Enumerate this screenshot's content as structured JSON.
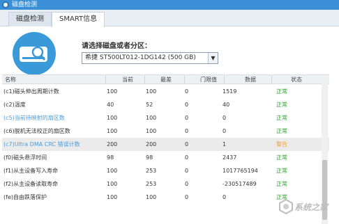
{
  "window": {
    "title": "磁盘检测"
  },
  "tabs": [
    {
      "label": "磁盘检测"
    },
    {
      "label": "SMART信息"
    }
  ],
  "selector": {
    "label": "请选择磁盘或者分区：",
    "value": "希捷 ST500LT012-1DG142  (500 GB)"
  },
  "table": {
    "columns": [
      "名称",
      "当前",
      "最差",
      "门限值",
      "数据",
      "状态"
    ],
    "rows": [
      {
        "name": "(c1)磁头伸出周期计数",
        "current": "100",
        "worst": "100",
        "threshold": "0",
        "data": "1519",
        "status": "正常"
      },
      {
        "name": "(c2)温度",
        "current": "40",
        "worst": "52",
        "threshold": "0",
        "data": "40",
        "status": "正常"
      },
      {
        "name": "(c5)当前待映射的扇区数",
        "current": "100",
        "worst": "100",
        "threshold": "0",
        "data": "0",
        "status": "正常"
      },
      {
        "name": "(c6)脱机无法校正的扇区数",
        "current": "100",
        "worst": "100",
        "threshold": "0",
        "data": "0",
        "status": "正常"
      },
      {
        "name": "(c7)Ultra DMA CRC 错误计数",
        "current": "200",
        "worst": "200",
        "threshold": "0",
        "data": "1",
        "status": "警告"
      },
      {
        "name": "(f0)磁头悬浮时间",
        "current": "98",
        "worst": "98",
        "threshold": "0",
        "data": "2437",
        "status": "正常"
      },
      {
        "name": "(f1)从主设备写入寿命",
        "current": "100",
        "worst": "253",
        "threshold": "0",
        "data": "1017765194",
        "status": "正常"
      },
      {
        "name": "(f2)从主设备读取寿命",
        "current": "100",
        "worst": "253",
        "threshold": "0",
        "data": "-230517489",
        "status": "正常"
      },
      {
        "name": "(fe)自由跌落保护",
        "current": "100",
        "worst": "100",
        "threshold": "0",
        "data": "0",
        "status": "正常"
      }
    ]
  },
  "watermark": {
    "text": "系统之家"
  },
  "colors": {
    "accent": "#3a9ad9",
    "ok": "#2ea12e",
    "warn": "#f0a030",
    "link": "#4a9de0"
  }
}
